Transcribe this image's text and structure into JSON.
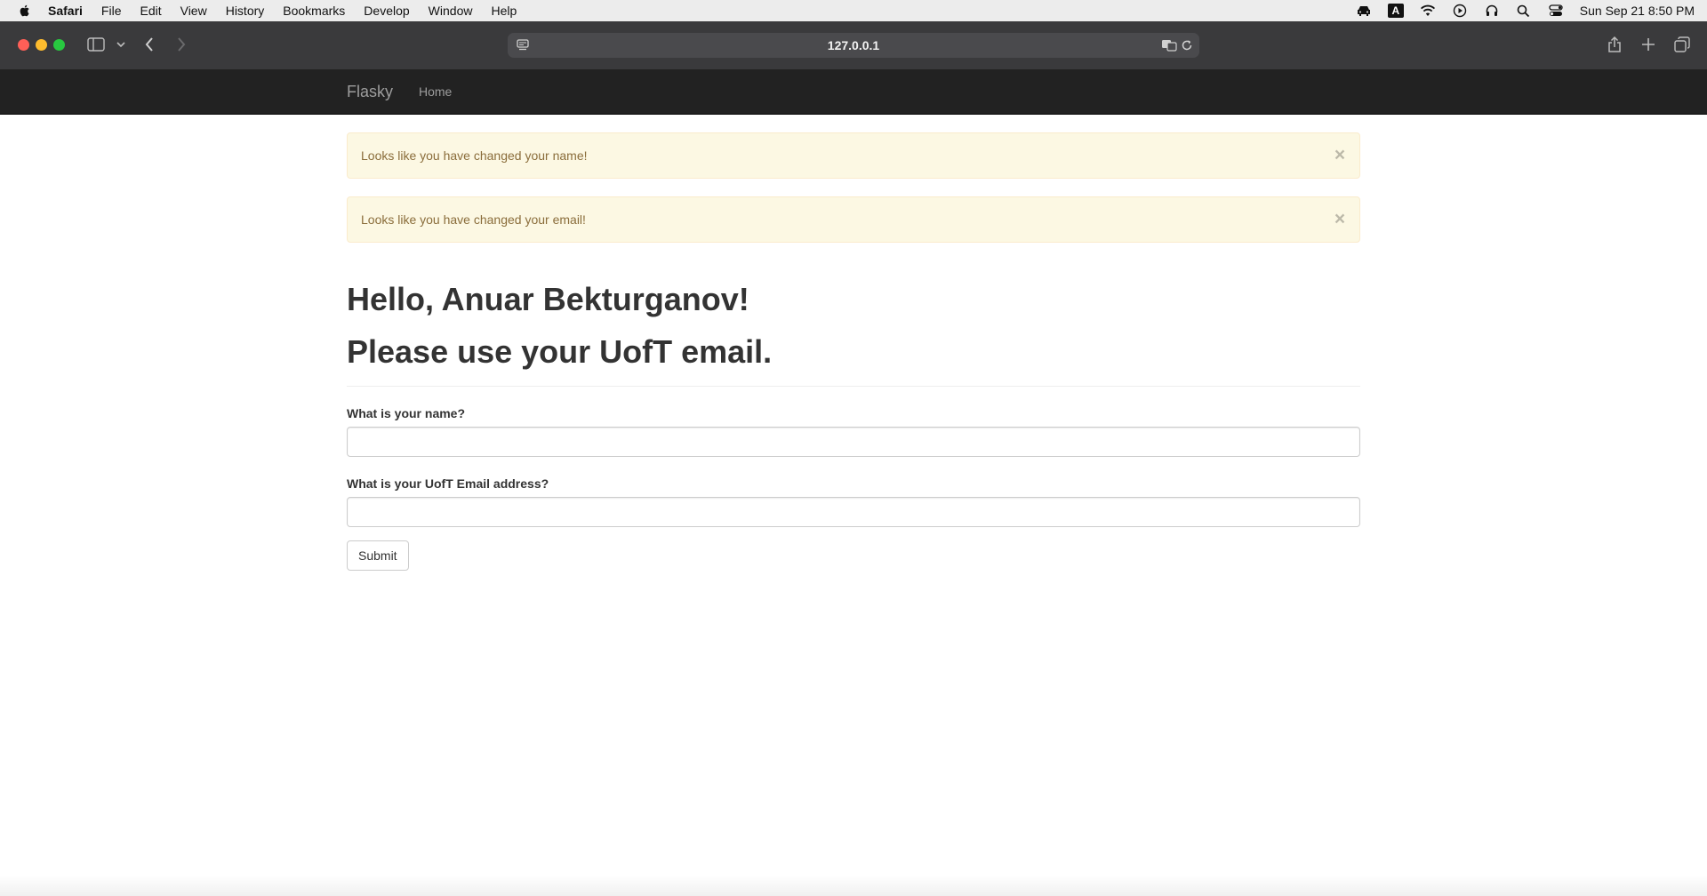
{
  "menubar": {
    "items": [
      "Safari",
      "File",
      "Edit",
      "View",
      "History",
      "Bookmarks",
      "Develop",
      "Window",
      "Help"
    ],
    "status_icons": [
      "car-icon",
      "keyboard-a-icon",
      "wifi-icon",
      "play-icon",
      "headphones-icon",
      "search-icon",
      "control-center-icon"
    ],
    "keyboard_letter": "A",
    "clock": "Sun Sep 21  8:50 PM"
  },
  "browser": {
    "url": "127.0.0.1"
  },
  "navbar": {
    "brand": "Flasky",
    "home": "Home"
  },
  "alerts": [
    {
      "message": "Looks like you have changed your name!",
      "close": "×"
    },
    {
      "message": "Looks like you have changed your email!",
      "close": "×"
    }
  ],
  "header": {
    "greeting": "Hello, Anuar Bekturganov!",
    "notice": "Please use your UofT email."
  },
  "form": {
    "name_label": "What is your name?",
    "name_value": "",
    "email_label": "What is your UofT Email address?",
    "email_value": "",
    "submit_label": "Submit"
  },
  "colors": {
    "navbar_bg": "#222222",
    "alert_bg": "#fcf8e3",
    "alert_text": "#8a6d3b",
    "toolbar_bg": "#3a3a3c"
  }
}
